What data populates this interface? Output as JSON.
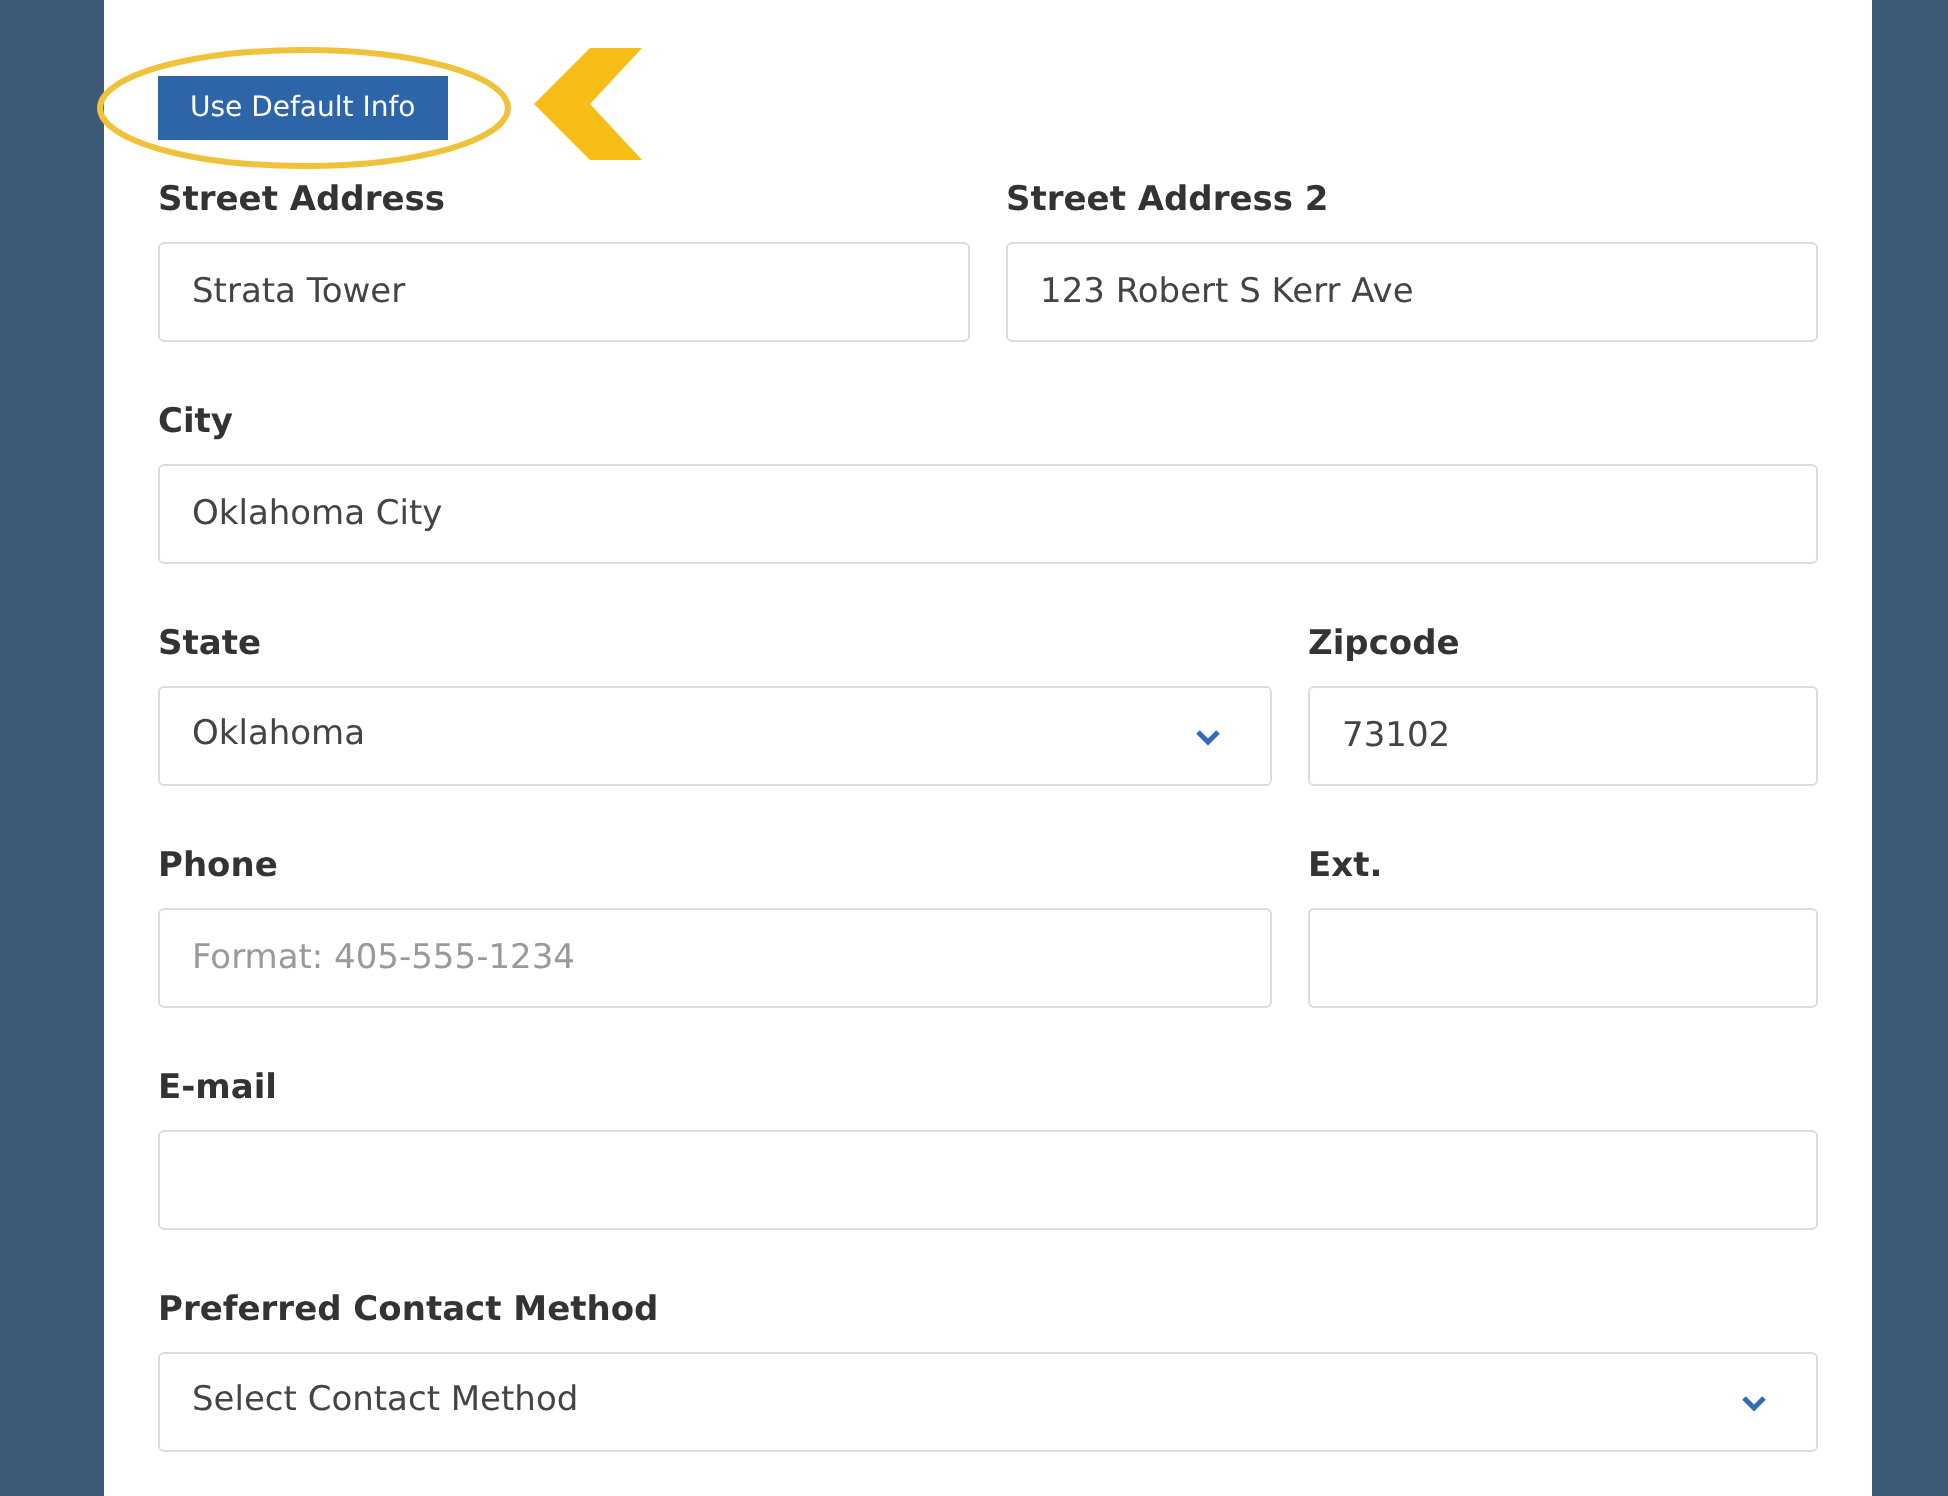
{
  "default_button": {
    "label": "Use Default Info",
    "highlighted": true
  },
  "rows": [
    {
      "fields": [
        {
          "label": "Street Address",
          "kind": "text",
          "value": "Strata Tower"
        },
        {
          "label": "Street Address 2",
          "kind": "text",
          "value": "123 Robert S Kerr Ave"
        }
      ]
    },
    {
      "fields": [
        {
          "label": "City",
          "kind": "text",
          "value": "Oklahoma City"
        }
      ]
    },
    {
      "fields": [
        {
          "label": "State",
          "kind": "select",
          "value": "Oklahoma"
        },
        {
          "label": "Zipcode",
          "kind": "text",
          "value": "73102"
        }
      ]
    },
    {
      "fields": [
        {
          "label": "Phone",
          "kind": "text",
          "placeholder": "Format: 405-555-1234"
        },
        {
          "label": "Ext.",
          "kind": "text"
        }
      ]
    },
    {
      "fields": [
        {
          "label": "E-mail",
          "kind": "text"
        }
      ]
    },
    {
      "fields": [
        {
          "label": "Preferred Contact Method",
          "kind": "select",
          "value": "Select Contact Method"
        }
      ]
    }
  ]
}
